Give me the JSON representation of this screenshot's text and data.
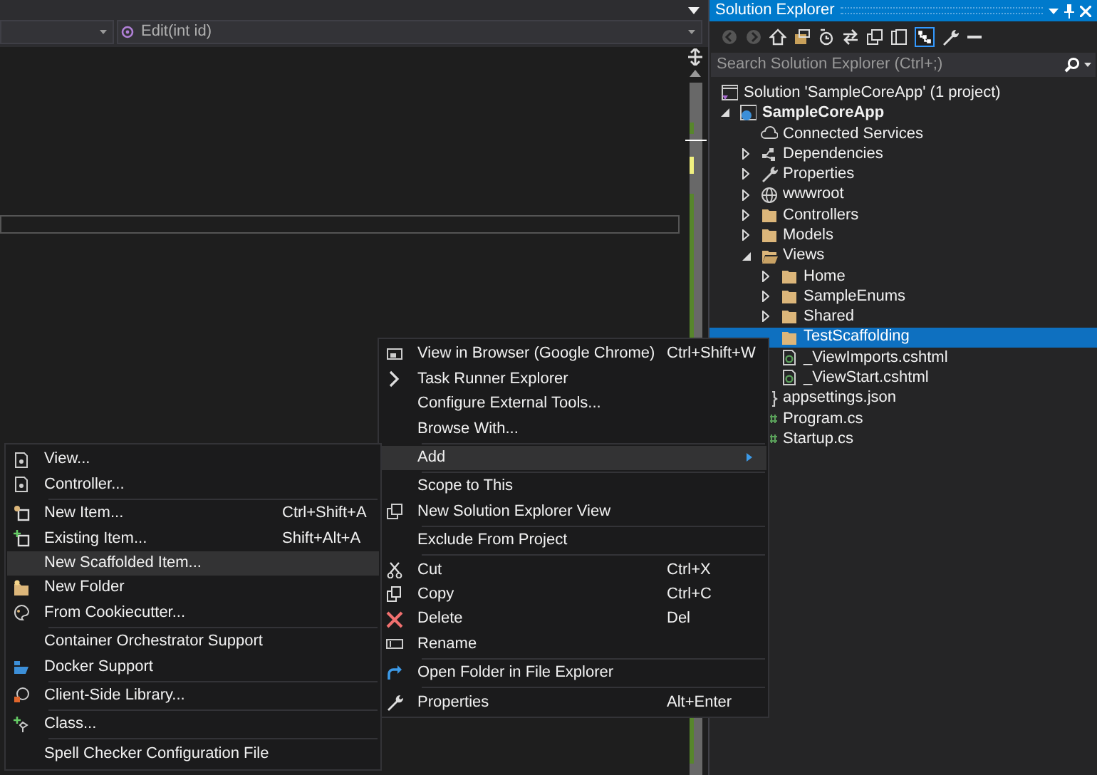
{
  "editor": {
    "nav_member": "Edit(int id)"
  },
  "solution_explorer": {
    "title": "Solution Explorer",
    "search": {
      "placeholder": "Search Solution Explorer (Ctrl+;)"
    },
    "tree": [
      {
        "label": "Solution 'SampleCoreApp' (1 project)",
        "kind": "solution",
        "selected": false,
        "children": [
          {
            "label": "SampleCoreApp",
            "kind": "project",
            "expanded": true,
            "selected": false,
            "children": [
              {
                "label": "Connected Services",
                "kind": "connected",
                "selected": false
              },
              {
                "label": "Dependencies",
                "kind": "dependencies",
                "expanded": false,
                "selected": false
              },
              {
                "label": "Properties",
                "kind": "properties",
                "expanded": false,
                "selected": false
              },
              {
                "label": "wwwroot",
                "kind": "web-root",
                "expanded": false,
                "selected": false
              },
              {
                "label": "Controllers",
                "kind": "folder",
                "expanded": false,
                "selected": false
              },
              {
                "label": "Models",
                "kind": "folder",
                "expanded": false,
                "selected": false
              },
              {
                "label": "Views",
                "kind": "open-folder",
                "expanded": true,
                "selected": false,
                "children": [
                  {
                    "label": "Home",
                    "kind": "folder",
                    "expanded": false,
                    "selected": false
                  },
                  {
                    "label": "SampleEnums",
                    "kind": "folder",
                    "expanded": false,
                    "selected": false
                  },
                  {
                    "label": "Shared",
                    "kind": "folder",
                    "expanded": false,
                    "selected": false
                  },
                  {
                    "label": "TestScaffolding",
                    "kind": "folder",
                    "selected": true
                  },
                  {
                    "label": "_ViewImports.cshtml",
                    "kind": "razor",
                    "selected": false
                  },
                  {
                    "label": "_ViewStart.cshtml",
                    "kind": "razor",
                    "selected": false
                  }
                ]
              },
              {
                "label": "appsettings.json",
                "kind": "json",
                "selected": false
              },
              {
                "label": "Program.cs",
                "kind": "csharp",
                "selected": false
              },
              {
                "label": "Startup.cs",
                "kind": "csharp",
                "selected": false
              }
            ]
          }
        ]
      }
    ]
  },
  "context_menu": {
    "items": [
      {
        "kind": "browser",
        "label": "View in Browser (Google Chrome)",
        "shortcut": "Ctrl+Shift+W",
        "highlighted": false
      },
      {
        "kind": "chevron",
        "label": "Task Runner Explorer",
        "highlighted": false
      },
      {
        "kind": "plain",
        "label": "Configure External Tools...",
        "highlighted": false
      },
      {
        "kind": "plain",
        "label": "Browse With...",
        "highlighted": false
      },
      {
        "kind": "separator"
      },
      {
        "kind": "plain",
        "label": "Add",
        "has_submenu": true,
        "highlighted": true
      },
      {
        "kind": "separator"
      },
      {
        "kind": "plain",
        "label": "Scope to This",
        "highlighted": false
      },
      {
        "kind": "new-view",
        "label": "New Solution Explorer View",
        "highlighted": false
      },
      {
        "kind": "separator"
      },
      {
        "kind": "plain",
        "label": "Exclude From Project",
        "highlighted": false
      },
      {
        "kind": "separator"
      },
      {
        "kind": "cut",
        "label": "Cut",
        "shortcut": "Ctrl+X",
        "highlighted": false
      },
      {
        "kind": "copy",
        "label": "Copy",
        "shortcut": "Ctrl+C",
        "highlighted": false
      },
      {
        "kind": "delete",
        "label": "Delete",
        "shortcut": "Del",
        "highlighted": false
      },
      {
        "kind": "rename",
        "label": "Rename",
        "highlighted": false
      },
      {
        "kind": "separator"
      },
      {
        "kind": "open-folder",
        "label": "Open Folder in File Explorer",
        "highlighted": false
      },
      {
        "kind": "separator"
      },
      {
        "kind": "wrench",
        "label": "Properties",
        "shortcut": "Alt+Enter",
        "highlighted": false
      }
    ]
  },
  "add_submenu": {
    "items": [
      {
        "kind": "page",
        "label": "View...",
        "highlighted": false
      },
      {
        "kind": "page",
        "label": "Controller...",
        "highlighted": false
      },
      {
        "kind": "separator"
      },
      {
        "kind": "new-item",
        "label": "New Item...",
        "shortcut": "Ctrl+Shift+A",
        "highlighted": false
      },
      {
        "kind": "existing-item",
        "label": "Existing Item...",
        "shortcut": "Shift+Alt+A",
        "highlighted": false
      },
      {
        "kind": "plain",
        "label": "New Scaffolded Item...",
        "highlighted": true
      },
      {
        "kind": "new-folder",
        "label": "New Folder",
        "highlighted": false
      },
      {
        "kind": "palette",
        "label": "From Cookiecutter...",
        "highlighted": false
      },
      {
        "kind": "separator"
      },
      {
        "kind": "plain",
        "label": "Container Orchestrator Support",
        "highlighted": false
      },
      {
        "kind": "docker",
        "label": "Docker Support",
        "highlighted": false
      },
      {
        "kind": "separator"
      },
      {
        "kind": "library",
        "label": "Client-Side Library...",
        "highlighted": false
      },
      {
        "kind": "separator"
      },
      {
        "kind": "class",
        "label": "Class...",
        "highlighted": false
      },
      {
        "kind": "separator"
      },
      {
        "kind": "plain",
        "label": "Spell Checker Configuration File",
        "highlighted": false
      }
    ]
  }
}
